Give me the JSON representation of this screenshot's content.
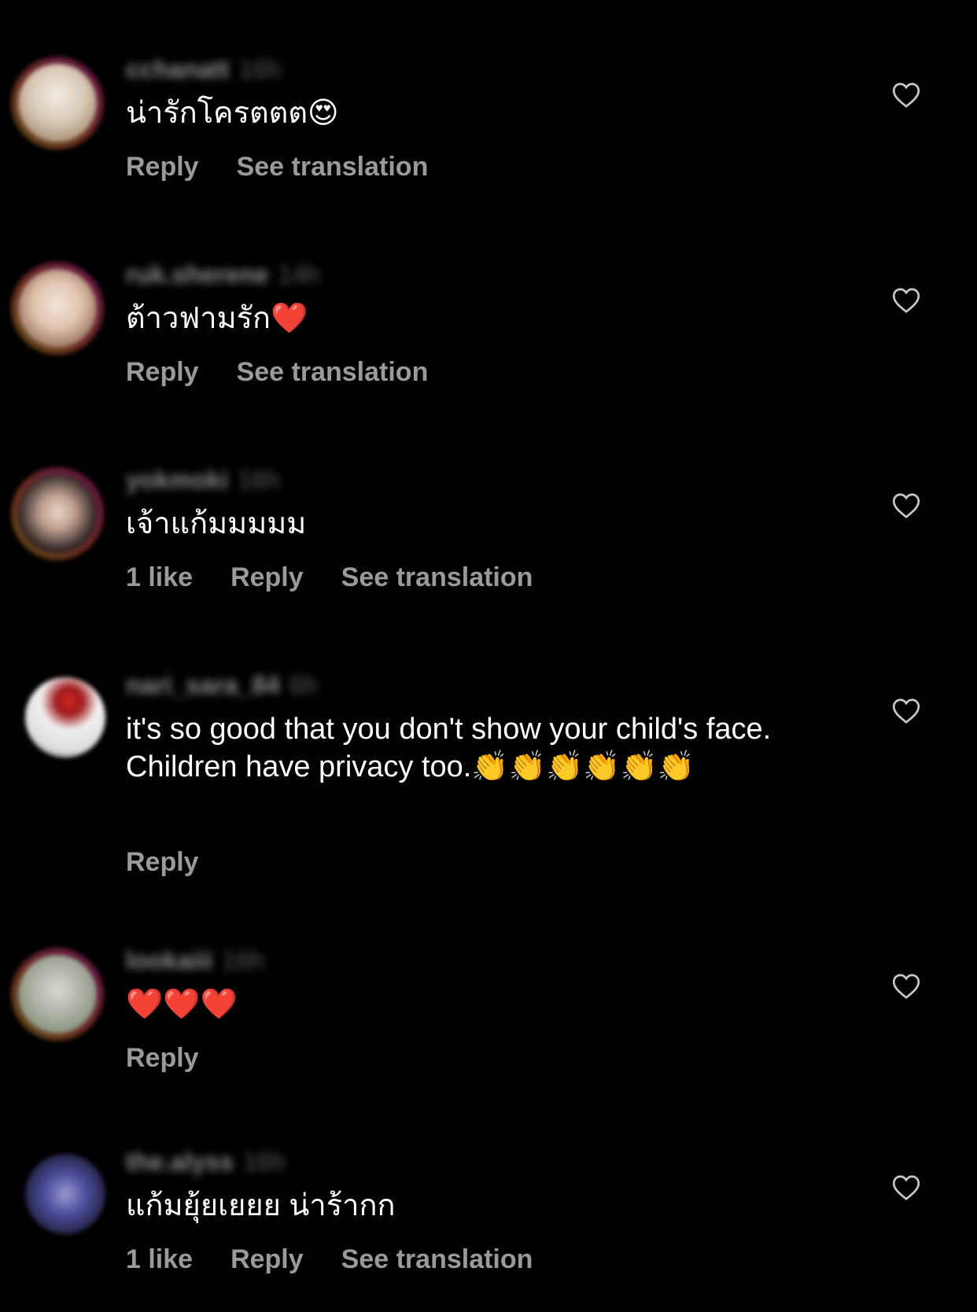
{
  "comments": [
    {
      "username": "cchanatt",
      "time": "16h",
      "text": "น่ารักโครตตต😍",
      "likes": "",
      "reply_label": "Reply",
      "translate_label": "See translation",
      "avatar_colors": [
        "#e8e0d8",
        "#b89a7a"
      ],
      "story_ring": true
    },
    {
      "username": "ruk.sherene",
      "time": "14h",
      "text": "ต้าวฟามรัก❤️",
      "likes": "",
      "reply_label": "Reply",
      "translate_label": "See translation",
      "avatar_colors": [
        "#f0ddd0",
        "#a07060"
      ],
      "story_ring": true
    },
    {
      "username": "yokmoki",
      "time": "16h",
      "text": "เจ้าแก้มมมมม",
      "likes": "1 like",
      "reply_label": "Reply",
      "translate_label": "See translation",
      "avatar_colors": [
        "#d0b8a8",
        "#2a2020"
      ],
      "story_ring": true
    },
    {
      "username": "nari_sara_84",
      "time": "6h",
      "text": "it's so good that you don't show your child's face. Children have privacy too.👏👏👏👏👏👏",
      "likes": "",
      "reply_label": "Reply",
      "translate_label": "",
      "avatar_colors": [
        "#f2f2f2",
        "#c02020"
      ],
      "story_ring": false
    },
    {
      "username": "lookaiii",
      "time": "16h",
      "text": "❤️❤️❤️",
      "likes": "",
      "reply_label": "Reply",
      "translate_label": "",
      "avatar_colors": [
        "#c8c8c0",
        "#7a8a70"
      ],
      "story_ring": true
    },
    {
      "username": "the.alyss",
      "time": "16h",
      "text": "แก้มยุ้ยเยยย น่าร้ากก",
      "likes": "1 like",
      "reply_label": "Reply",
      "translate_label": "See translation",
      "avatar_colors": [
        "#8080c0",
        "#202040"
      ],
      "story_ring": false
    }
  ],
  "colors": {
    "background": "#000000",
    "text": "#ffffff",
    "meta": "#9a9a9a"
  },
  "icons": {
    "like": "heart-outline-icon"
  }
}
